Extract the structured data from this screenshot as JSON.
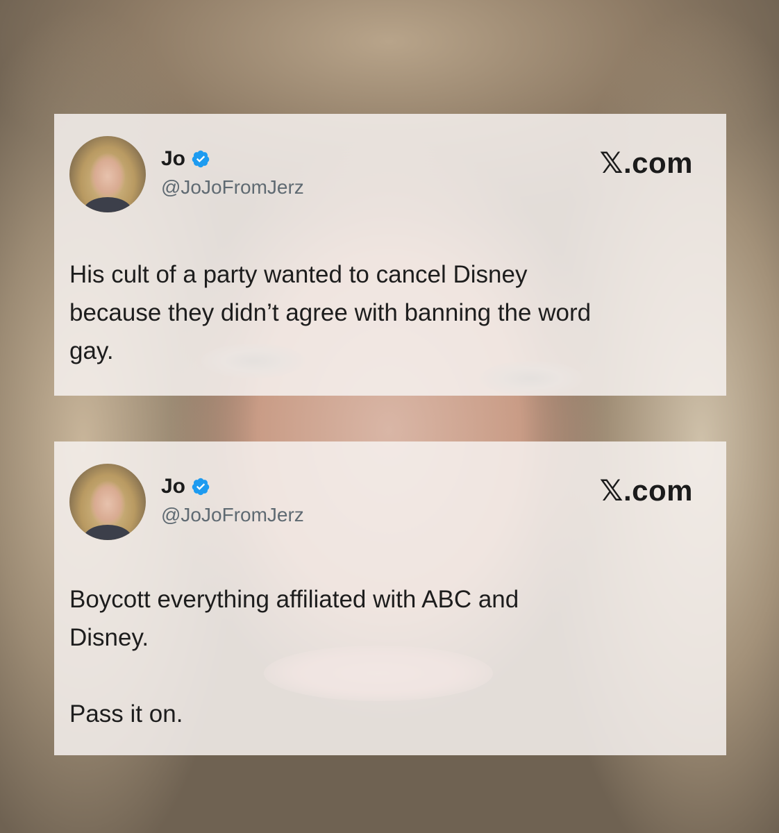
{
  "tweets": [
    {
      "name": "Jo",
      "handle": "@JoJoFromJerz",
      "site": "𝕏.com",
      "text": "His cult of a party wanted to cancel Disney\nbecause they didn’t agree with banning the word\ngay.",
      "verified_icon": "verified-badge-icon",
      "verified_color": "#1d9bf0"
    },
    {
      "name": "Jo",
      "handle": "@JoJoFromJerz",
      "site": "𝕏.com",
      "text": "Boycott everything affiliated with ABC and\nDisney.\n\nPass it on.",
      "verified_icon": "verified-badge-icon",
      "verified_color": "#1d9bf0"
    }
  ]
}
